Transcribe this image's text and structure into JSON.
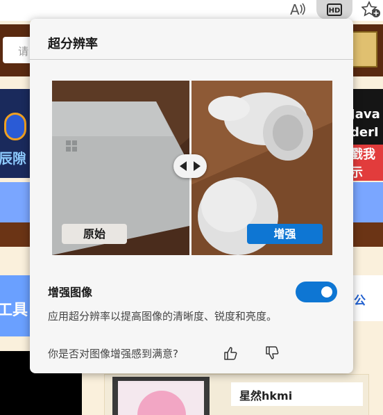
{
  "toolbar": {
    "read_aloud_icon": "read-aloud-icon",
    "hd_icon_label": "HD",
    "favorites_icon": "add-favorite-icon"
  },
  "background_page": {
    "search_fragment": "请",
    "banner_text_left": "辰隙",
    "banner_text_right_1": "Java",
    "banner_text_right_2": "derI",
    "banner_text_right_3": "戳我示",
    "tools_text": "工具",
    "right_fragment": "公",
    "card_name": "星然hkmi"
  },
  "popup": {
    "title": "超分辨率",
    "compare": {
      "label_original": "原始",
      "label_enhanced": "增强"
    },
    "setting": {
      "title": "增强图像",
      "enabled": true,
      "description": "应用超分辨率以提高图像的清晰度、锐度和亮度。"
    },
    "feedback": {
      "question": "你是否对图像增强感到满意?"
    }
  },
  "colors": {
    "accent": "#0e76d3",
    "popup_bg": "#f6f6f6"
  }
}
